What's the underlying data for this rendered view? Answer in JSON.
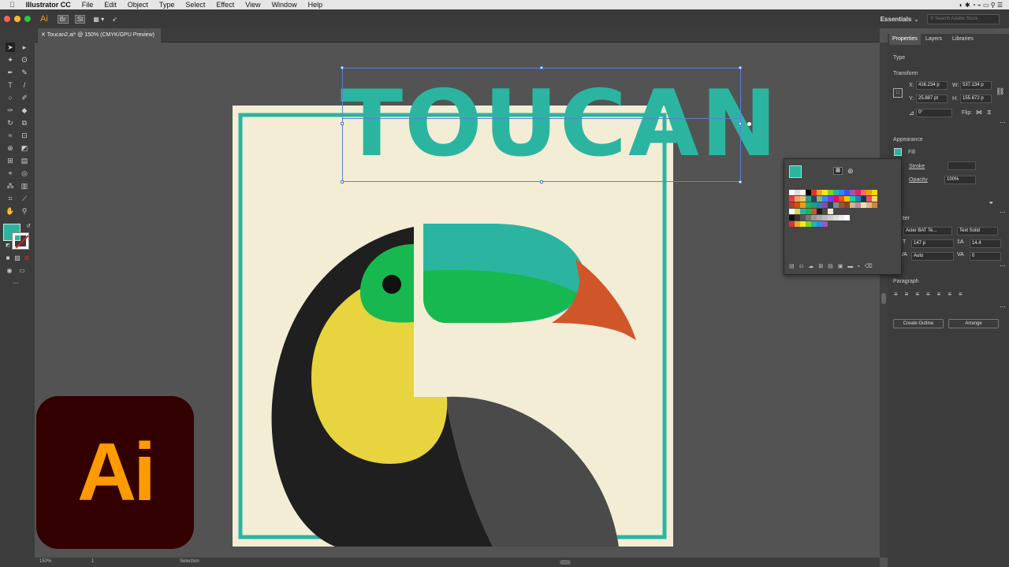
{
  "menubar": {
    "apple": "",
    "app": "Illustrator CC",
    "items": [
      "File",
      "Edit",
      "Object",
      "Type",
      "Select",
      "Effect",
      "View",
      "Window",
      "Help"
    ]
  },
  "appbar": {
    "logo": "Ai",
    "br": "Br",
    "st": "St",
    "workspace": "Essentials",
    "search_placeholder": "Search Adobe Stock"
  },
  "document": {
    "tab_title": "Toucan2.ai* @ 150% (CMYK/GPU Preview)"
  },
  "artwork": {
    "title_text": "TOUCAN",
    "colors": {
      "teal": "#2bb5a0",
      "green": "#17b84f",
      "yellow": "#e8d43f",
      "orange": "#d0562a",
      "black": "#1f1f1f",
      "gray": "#4a4a4a",
      "cream": "#f3edd6"
    }
  },
  "status": {
    "zoom": "150%",
    "artboard": "1",
    "tool": "Selection"
  },
  "panel": {
    "tabs": [
      "Properties",
      "Layers",
      "Libraries"
    ],
    "type_label": "Type",
    "transform_label": "Transform",
    "x_label": "X:",
    "x_value": "416.234 p",
    "y_label": "Y:",
    "y_value": "25.887 pt",
    "w_label": "W:",
    "w_value": "537.134 p",
    "h_label": "H:",
    "h_value": "155.672 p",
    "rotate_value": "0°",
    "flip_label": "Flip:",
    "appearance_label": "Appearance",
    "fill_label": "Fill",
    "stroke_label": "Stroke",
    "opacity_label": "Opacity",
    "opacity_value": "100%",
    "character_label": "racter",
    "font_family": "Acier BAT Te...",
    "font_style": "Text Solid",
    "font_size": "147 p",
    "leading": "14.4",
    "kerning": "Auto",
    "tracking": "0",
    "paragraph_label": "Paragraph",
    "create_outline": "Create Outline",
    "arrange": "Arrange"
  },
  "accent": "#2bb5a0"
}
